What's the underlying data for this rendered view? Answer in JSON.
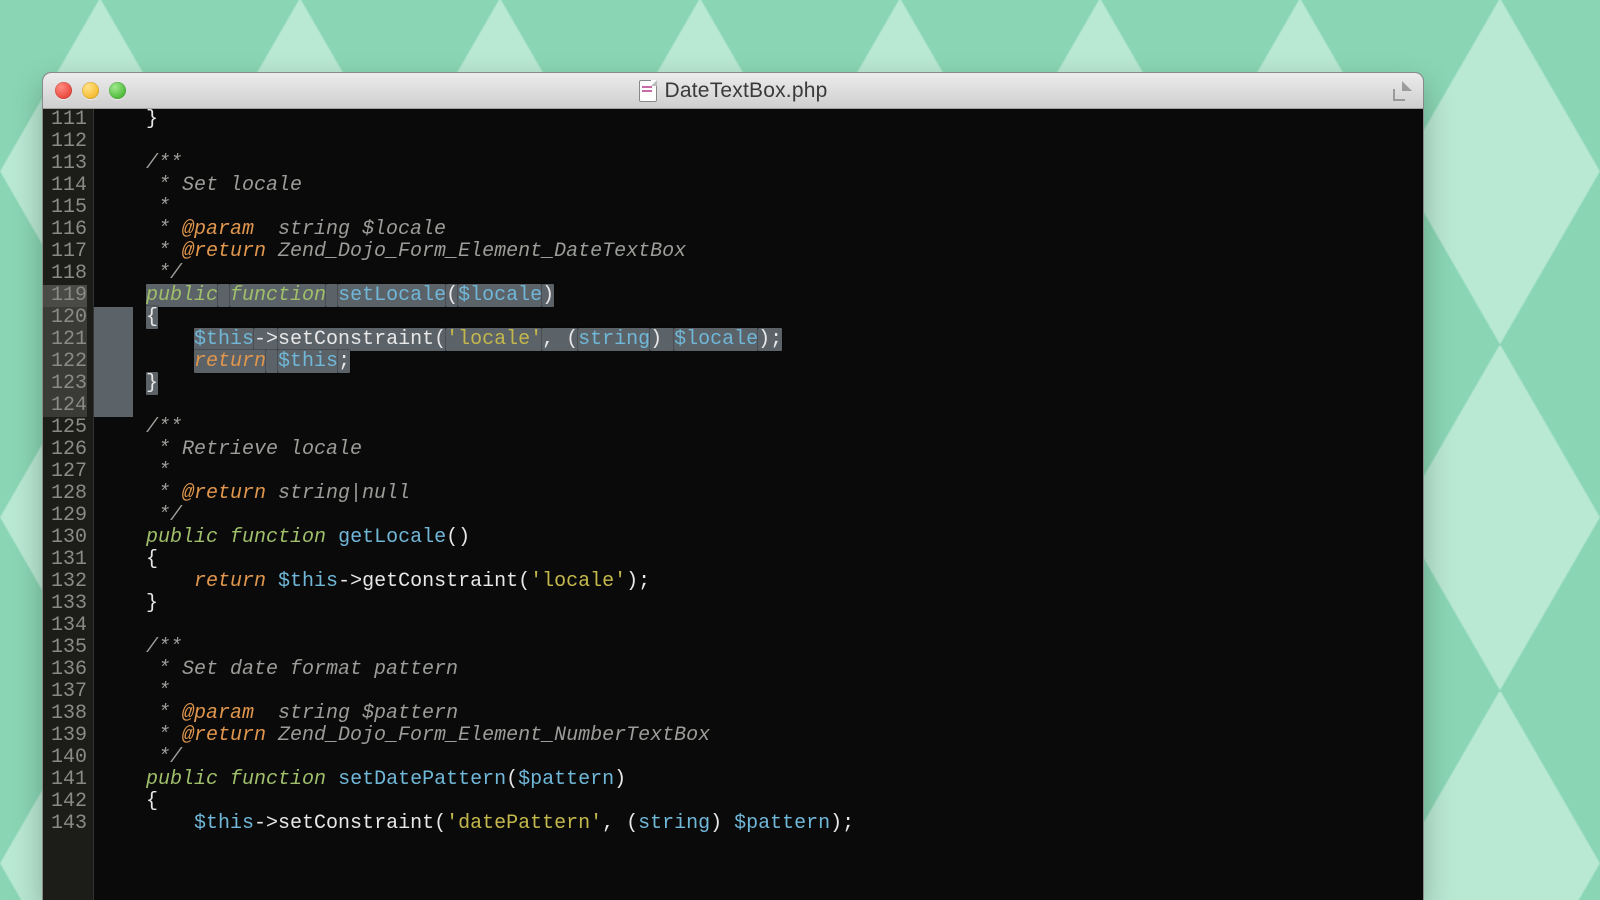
{
  "window": {
    "title": "DateTextBox.php"
  },
  "gutter": {
    "start": 111,
    "end": 143,
    "highlighted_current": 119,
    "selection_start": 119,
    "selection_end": 124
  },
  "colors": {
    "keyword": "#9fbf6b",
    "function": "#70b7d8",
    "variable": "#70b7d8",
    "string": "#c4b84c",
    "comment": "#9b9d98",
    "doctag": "#e0964d",
    "bg": "#0a0a0a",
    "gutter_bg": "#1c1c19",
    "selection": "#5b6268"
  },
  "code": {
    "111": {
      "plain": "    }"
    },
    "112": {
      "plain": ""
    },
    "113": {
      "comment": "    /**"
    },
    "114": {
      "comment": "     * Set locale"
    },
    "115": {
      "comment": "     *"
    },
    "116": {
      "comment_prefix": "     * ",
      "doctag": "@param",
      "comment_suffix": "  string $locale"
    },
    "117": {
      "comment_prefix": "     * ",
      "doctag": "@return",
      "comment_suffix": " Zend_Dojo_Form_Element_DateTextBox"
    },
    "118": {
      "comment": "     */"
    },
    "119": {
      "indent": "    ",
      "kw1": "public",
      "kw2": "function",
      "fn": "setLocale",
      "punct1": "(",
      "var": "$locale",
      "punct2": ")"
    },
    "120": {
      "indent": "    ",
      "brace": "{"
    },
    "121": {
      "indent": "        ",
      "var1": "$this",
      "arrow": "->",
      "call": "setConstraint(",
      "str": "'locale'",
      "mid": ", (",
      "cast": "string",
      "mid2": ") ",
      "var2": "$locale",
      "end": ");"
    },
    "122": {
      "indent": "        ",
      "kw": "return",
      "sp": " ",
      "var": "$this",
      "semi": ";"
    },
    "123": {
      "indent": "    ",
      "brace": "}"
    },
    "124": {
      "plain": ""
    },
    "125": {
      "comment": "    /**"
    },
    "126": {
      "comment": "     * Retrieve locale"
    },
    "127": {
      "comment": "     *"
    },
    "128": {
      "comment_prefix": "     * ",
      "doctag": "@return",
      "comment_suffix": " string|null"
    },
    "129": {
      "comment": "     */"
    },
    "130": {
      "indent": "    ",
      "kw1": "public",
      "kw2": "function",
      "fn": "getLocale",
      "punct1": "(",
      "punct2": ")"
    },
    "131": {
      "plain": "    {"
    },
    "132": {
      "indent": "        ",
      "kw": "return",
      "sp": " ",
      "var": "$this",
      "arrow": "->",
      "call": "getConstraint(",
      "str": "'locale'",
      "end": ");"
    },
    "133": {
      "plain": "    }"
    },
    "134": {
      "plain": ""
    },
    "135": {
      "comment": "    /**"
    },
    "136": {
      "comment": "     * Set date format pattern"
    },
    "137": {
      "comment": "     *"
    },
    "138": {
      "comment_prefix": "     * ",
      "doctag": "@param",
      "comment_suffix": "  string $pattern"
    },
    "139": {
      "comment_prefix": "     * ",
      "doctag": "@return",
      "comment_suffix": " Zend_Dojo_Form_Element_NumberTextBox"
    },
    "140": {
      "comment": "     */"
    },
    "141": {
      "indent": "    ",
      "kw1": "public",
      "kw2": "function",
      "fn": "setDatePattern",
      "punct1": "(",
      "var": "$pattern",
      "punct2": ")"
    },
    "142": {
      "plain": "    {"
    },
    "143": {
      "indent": "        ",
      "var1": "$this",
      "arrow": "->",
      "call": "setConstraint(",
      "str": "'datePattern'",
      "mid": ", (",
      "cast": "string",
      "mid2": ") ",
      "var2": "$pattern",
      "end": ");"
    }
  }
}
